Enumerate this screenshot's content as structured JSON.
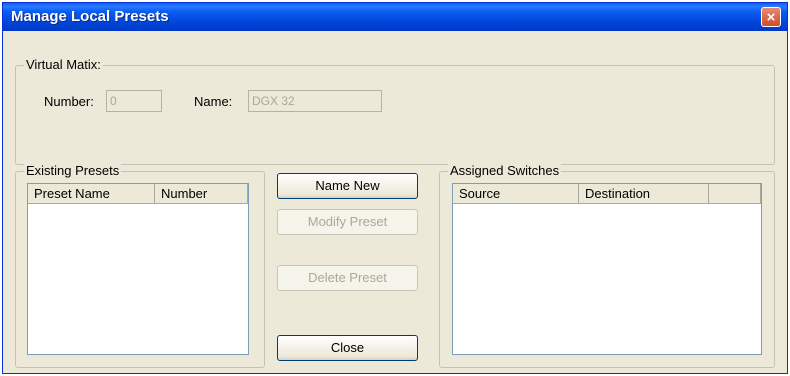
{
  "window": {
    "title": "Manage Local Presets",
    "close_glyph": "×"
  },
  "virtual_matrix": {
    "legend": "Virtual Matix:",
    "number_label": "Number:",
    "number_value": "0",
    "name_label": "Name:",
    "name_value": "DGX 32"
  },
  "existing_presets": {
    "legend": "Existing Presets",
    "columns": [
      "Preset Name",
      "Number"
    ]
  },
  "buttons": {
    "name_new": "Name New",
    "modify_preset": "Modify Preset",
    "delete_preset": "Delete Preset",
    "close": "Close"
  },
  "assigned_switches": {
    "legend": "Assigned Switches",
    "columns": [
      "Source",
      "Destination",
      ""
    ]
  },
  "colors": {
    "title_bar": "#0a5ef5",
    "dialog_bg": "#ece9d8",
    "close_button": "#d04c2d"
  }
}
